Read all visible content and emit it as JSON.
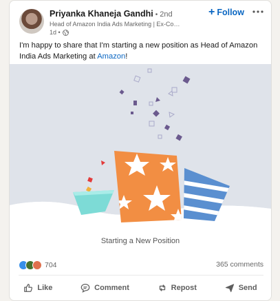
{
  "post": {
    "author": {
      "name": "Priyanka Khaneja Gandhi",
      "separator": "•",
      "degree": "2nd",
      "headline": "Head of Amazon India Ads Marketing | Ex-Colgate-Pal...",
      "time": "1d •"
    },
    "follow_label": "Follow",
    "text_prefix": "I'm happy to share that I'm starting a new position as Head of Amazon India Ads Marketing at ",
    "text_link": "Amazon",
    "text_suffix": "!",
    "caption": "Starting a New Position",
    "reaction_count": "704",
    "comments_label": "365 comments",
    "actions": {
      "like": "Like",
      "comment": "Comment",
      "repost": "Repost",
      "send": "Send"
    }
  },
  "colors": {
    "accent": "#0a66c2",
    "orange_box": "#f28e43",
    "teal_box": "#7ddbd6",
    "blue_box": "#5a8fd0",
    "confetti": "#6b5a8e",
    "backdrop": "#dfe3ea"
  }
}
